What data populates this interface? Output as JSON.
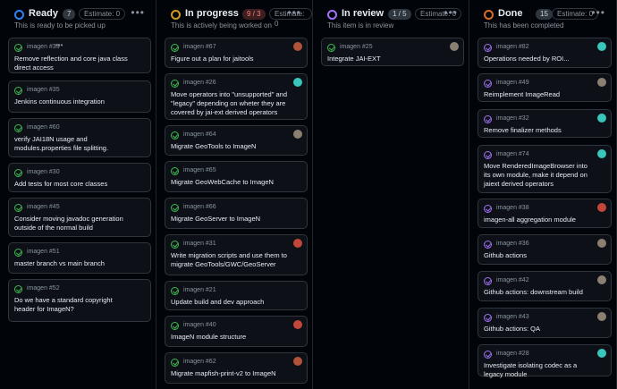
{
  "colors": {
    "bg": "#010409",
    "card": "#0d1117",
    "border": "#30363d",
    "open": "#3fb950",
    "done": "#a371f7"
  },
  "columns": [
    {
      "title": "Ready",
      "count": "7",
      "count_style": "normal",
      "estimate": "Estimate: 0",
      "subtitle": "This is ready to be picked up",
      "ring": "#2f81f7",
      "cards": [
        {
          "id": "imagen #33",
          "title": "Remove reflection and core java class direct access",
          "state": "open",
          "avatar": ""
        },
        {
          "id": "imagen #35",
          "title": "Jenkins continuous integration",
          "state": "open",
          "avatar": ""
        },
        {
          "id": "imagen #60",
          "title": "verify JAI18N usage and modules.properties file splitting.",
          "state": "open",
          "avatar": ""
        },
        {
          "id": "imagen #30",
          "title": "Add tests for most core classes",
          "state": "open",
          "avatar": ""
        },
        {
          "id": "imagen #45",
          "title": "Consider moving javadoc generation outside of the normal build",
          "state": "open",
          "avatar": ""
        },
        {
          "id": "imagen #51",
          "title": "master branch vs main branch",
          "state": "open",
          "avatar": ""
        },
        {
          "id": "imagen #52",
          "title": "Do we have a standard copyright header for ImageN?",
          "state": "open",
          "avatar": ""
        }
      ]
    },
    {
      "title": "In progress",
      "count": "9 / 3",
      "count_style": "red",
      "estimate": "Estimate: 0",
      "subtitle": "This is actively being worked on",
      "ring": "#d29922",
      "cards": [
        {
          "id": "imagen #67",
          "title": "Figure out a plan for jaitools",
          "state": "open",
          "avatar": "#b0533a"
        },
        {
          "id": "imagen #26",
          "title": "Move operators into \"unsupported\" and \"legacy\" depending on wheter they are covered by jai-ext derived operators",
          "state": "open",
          "avatar": "#39c5bb"
        },
        {
          "id": "imagen #64",
          "title": "Migrate GeoTools to ImageN",
          "state": "open",
          "avatar": "#8a7f70"
        },
        {
          "id": "imagen #65",
          "title": "Migrate GeoWebCache to ImageN",
          "state": "open",
          "avatar": ""
        },
        {
          "id": "imagen #66",
          "title": "Migrate GeoServer to ImageN",
          "state": "open",
          "avatar": ""
        },
        {
          "id": "imagen #31",
          "title": "Write migration scripts and use them to migrate GeoTools/GWC/GeoServer",
          "state": "open",
          "avatar": "#c2463a"
        },
        {
          "id": "imagen #21",
          "title": "Update build and dev approach",
          "state": "open",
          "avatar": ""
        },
        {
          "id": "imagen #40",
          "title": "ImageN module structure",
          "state": "open",
          "avatar": "#c2463a"
        },
        {
          "id": "imagen #62",
          "title": "Migrate mapfish-print-v2 to ImageN",
          "state": "open",
          "avatar": "#b0533a"
        }
      ]
    },
    {
      "title": "In review",
      "count": "1 / 5",
      "count_style": "normal",
      "estimate": "Estimate: 0",
      "subtitle": "This item is in review",
      "ring": "#a371f7",
      "cards": [
        {
          "id": "imagen #25",
          "title": "Integrate JAI-EXT",
          "state": "open",
          "avatar": "#8a7f70"
        }
      ]
    },
    {
      "title": "Done",
      "count": "15",
      "count_style": "normal",
      "estimate": "Estimate: 0",
      "subtitle": "This has been completed",
      "ring": "#db6d28",
      "cards": [
        {
          "id": "imagen #82",
          "title": "Operations needed by ROI...",
          "state": "done",
          "avatar": "#39c5bb"
        },
        {
          "id": "imagen #49",
          "title": "Reimplement ImageRead",
          "state": "done",
          "avatar": "#8a7f70"
        },
        {
          "id": "imagen #32",
          "title": "Remove finalizer methods",
          "state": "done",
          "avatar": "#39c5bb"
        },
        {
          "id": "imagen #74",
          "title": "Move RenderedImageBrowser into its own module, make it depend on jaiext derived operators",
          "state": "done",
          "avatar": "#39c5bb"
        },
        {
          "id": "imagen #38",
          "title": "imagen-all aggregation module",
          "state": "done",
          "avatar": "#c2463a"
        },
        {
          "id": "imagen #36",
          "title": "Github actions",
          "state": "done",
          "avatar": "#8a7f70"
        },
        {
          "id": "imagen #42",
          "title": "Github actions: downstream build",
          "state": "done",
          "avatar": "#8a7f70"
        },
        {
          "id": "imagen #43",
          "title": "Github actions: QA",
          "state": "done",
          "avatar": "#8a7f70"
        },
        {
          "id": "imagen #28",
          "title": "Investigate isolating codec as a legacy module",
          "state": "done",
          "avatar": "#39c5bb"
        }
      ]
    }
  ]
}
